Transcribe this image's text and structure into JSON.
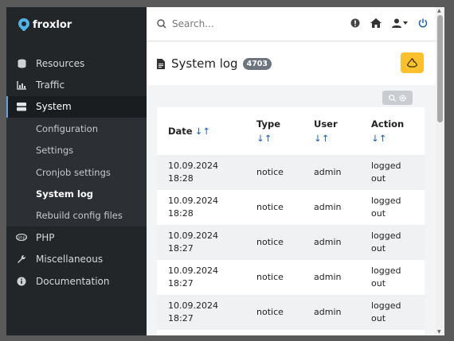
{
  "brand": {
    "name": "froxlor"
  },
  "search": {
    "placeholder": "Search..."
  },
  "sidebar": {
    "items": [
      {
        "label": "Resources",
        "icon": "database-icon"
      },
      {
        "label": "Traffic",
        "icon": "chart-icon"
      },
      {
        "label": "System",
        "icon": "server-icon"
      },
      {
        "label": "PHP",
        "icon": "php-icon"
      },
      {
        "label": "Miscellaneous",
        "icon": "wrench-icon"
      },
      {
        "label": "Documentation",
        "icon": "info-icon"
      }
    ],
    "system_sub": [
      {
        "label": "Configuration"
      },
      {
        "label": "Settings"
      },
      {
        "label": "Cronjob settings"
      },
      {
        "label": "System log"
      },
      {
        "label": "Rebuild config files"
      }
    ]
  },
  "header": {
    "title": "System log",
    "count": "4703"
  },
  "table": {
    "columns": [
      {
        "label": "Date",
        "sort": "↓↑"
      },
      {
        "label": "Type",
        "sort": "↓↑"
      },
      {
        "label": "User",
        "sort": "↓↑"
      },
      {
        "label": "Action",
        "sort": "↓↑"
      }
    ],
    "rows": [
      {
        "date": "10.09.2024",
        "time": "18:28",
        "type": "notice",
        "user": "admin",
        "action1": "logged",
        "action2": "out"
      },
      {
        "date": "10.09.2024",
        "time": "18:28",
        "type": "notice",
        "user": "admin",
        "action1": "logged",
        "action2": "out"
      },
      {
        "date": "10.09.2024",
        "time": "18:27",
        "type": "notice",
        "user": "admin",
        "action1": "logged",
        "action2": "out"
      },
      {
        "date": "10.09.2024",
        "time": "18:27",
        "type": "notice",
        "user": "admin",
        "action1": "logged",
        "action2": "out"
      },
      {
        "date": "10.09.2024",
        "time": "18:27",
        "type": "notice",
        "user": "admin",
        "action1": "logged",
        "action2": "out"
      }
    ]
  },
  "colors": {
    "sidebar_bg": "#222629",
    "accent": "#fbc02d",
    "sort_arrow": "#1a5fa8",
    "badge": "#6c757d",
    "logout": "#1a5fa8"
  }
}
